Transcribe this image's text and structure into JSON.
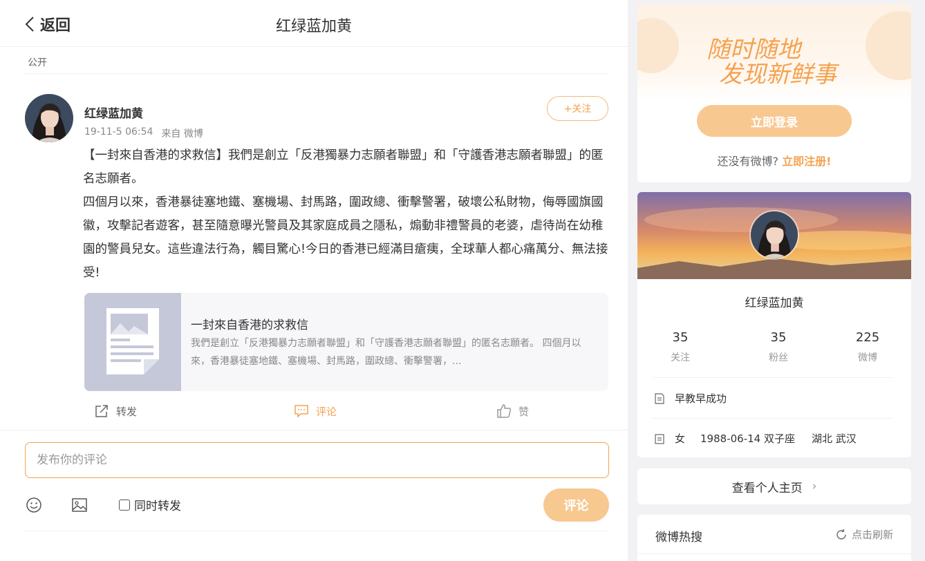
{
  "header": {
    "back_label": "返回",
    "title": "红绿蓝加黄"
  },
  "post": {
    "visibility": "公开",
    "author": "红绿蓝加黄",
    "time": "19-11-5 06:54",
    "source": "来自 微博",
    "follow_label": "+关注",
    "paragraphs": [
      "【一封來自香港的求救信】我們是創立「反港獨暴力志願者聯盟」和「守護香港志願者聯盟」的匿名志願者。",
      "四個月以來，香港暴徒塞地鐵、塞機場、封馬路，圍政總、衝擊警署，破壞公私財物，侮辱國旗國徽，攻擊記者遊客，甚至隨意曝光警員及其家庭成員之隱私，煽動非禮警員的老婆，虐待尚在幼稚園的警員兒女。這些違法行為，觸目驚心!今日的香港已經滿目瘡痍，全球華人都心痛萬分、無法接受!"
    ],
    "card": {
      "title": "一封來自香港的求救信",
      "desc": "我們是創立「反港獨暴力志願者聯盟」和「守護香港志願者聯盟」的匿名志願者。 四個月以來，香港暴徒塞地鐵、塞機場、封馬路，圍政總、衝擊警署，..."
    },
    "actions": {
      "repost": "转发",
      "comment": "评论",
      "like": "赞"
    }
  },
  "composer": {
    "placeholder": "发布你的评论",
    "repost_label": "同时转发",
    "submit_label": "评论"
  },
  "sidebar": {
    "slogan_line1": "随时随地",
    "slogan_line2": "发现新鲜事",
    "login_label": "立即登录",
    "register_prompt": "还没有微博?",
    "register_link": "立即注册!",
    "profile": {
      "name": "红绿蓝加黄",
      "stats": [
        {
          "num": "35",
          "label": "关注"
        },
        {
          "num": "35",
          "label": "粉丝"
        },
        {
          "num": "225",
          "label": "微博"
        }
      ],
      "bio": "早教早成功",
      "gender": "女",
      "birthday": "1988-06-14 双子座",
      "location": "湖北 武汉"
    },
    "homepage_label": "查看个人主页",
    "hot": {
      "title": "微博热搜",
      "refresh_label": "点击刷新"
    }
  },
  "colors": {
    "accent": "#f5a250",
    "button_fill": "#f8c891"
  }
}
